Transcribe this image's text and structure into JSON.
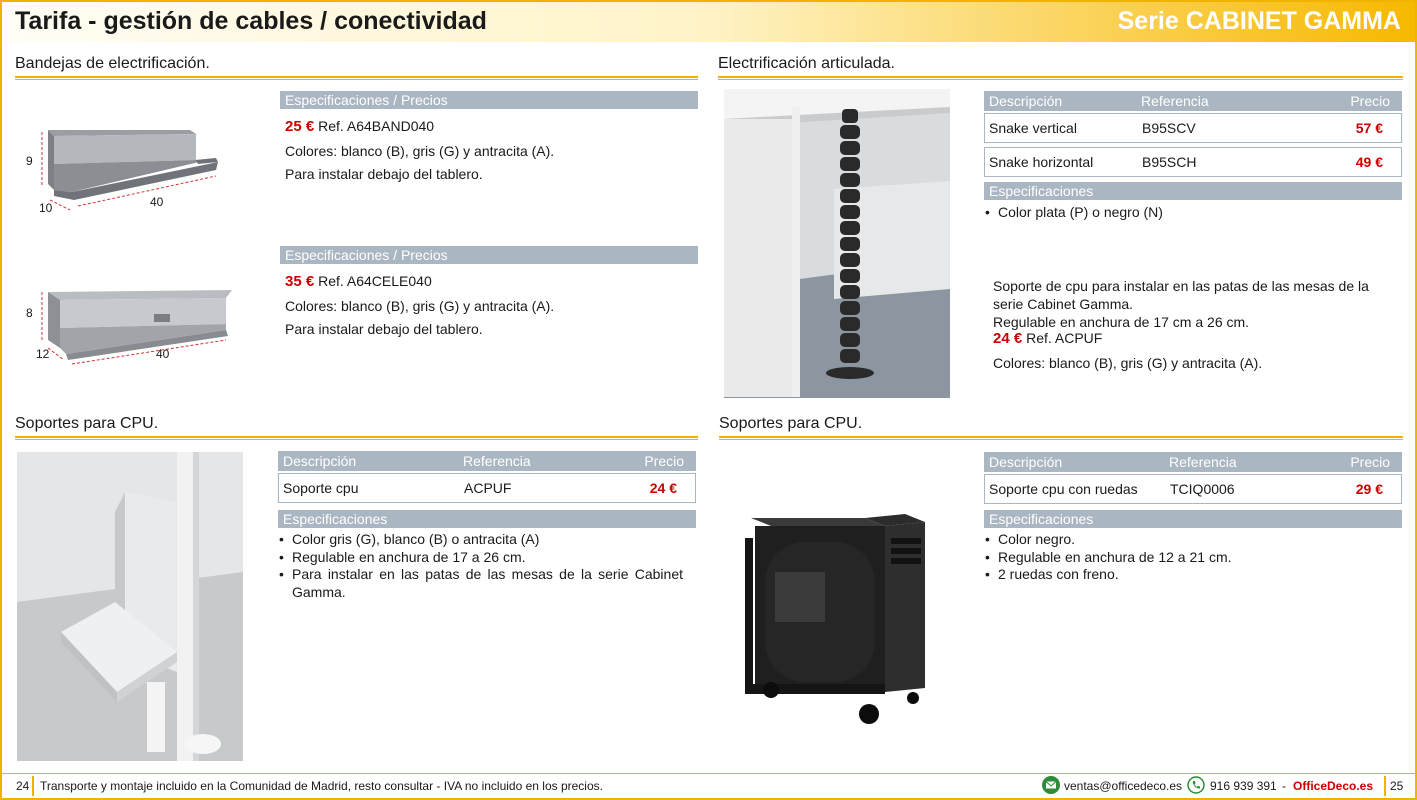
{
  "header": {
    "title": "Tarifa - gestión de cables / conectividad",
    "series": "Serie CABINET GAMMA"
  },
  "bandejas": {
    "title": "Bandejas de electrificación.",
    "items": [
      {
        "spec_label": "Especificaciones / Precios",
        "price": "25 €",
        "ref": "Ref. A64BAND040",
        "colors": "Colores: blanco (B), gris (G) y antracita (A).",
        "install": "Para instalar debajo del tablero.",
        "dims": {
          "h": "9",
          "w": "10",
          "l": "40"
        }
      },
      {
        "spec_label": "Especificaciones / Precios",
        "price": "35 €",
        "ref": "Ref. A64CELE040",
        "colors": "Colores: blanco (B), gris (G) y antracita (A).",
        "install": "Para instalar debajo del tablero.",
        "dims": {
          "h": "8",
          "w": "12",
          "l": "40"
        }
      }
    ]
  },
  "articulada": {
    "title": "Electrificación articulada.",
    "headers": {
      "desc": "Descripción",
      "ref": "Referencia",
      "price": "Precio"
    },
    "rows": [
      {
        "desc": "Snake vertical",
        "ref": "B95SCV",
        "price": "57 €"
      },
      {
        "desc": "Snake horizontal",
        "ref": "B95SCH",
        "price": "49 €"
      }
    ],
    "spec_label": "Especificaciones",
    "bullets": [
      "Color plata (P) o negro (N)"
    ],
    "cpu_note": {
      "line1": "Soporte de cpu para instalar en las patas de las mesas de la",
      "line2": "serie Cabinet Gamma.",
      "line3": "Regulable en anchura de 17 cm a 26 cm.",
      "price": "24 €",
      "ref": "Ref. ACPUF",
      "colors": "Colores: blanco (B), gris (G) y antracita (A)."
    }
  },
  "soporte_left": {
    "title": "Soportes para CPU.",
    "headers": {
      "desc": "Descripción",
      "ref": "Referencia",
      "price": "Precio"
    },
    "row": {
      "desc": "Soporte cpu",
      "ref": "ACPUF",
      "price": "24 €"
    },
    "spec_label": "Especificaciones",
    "bullets": [
      "Color gris (G), blanco (B) o antracita (A)",
      "Regulable en anchura de 17 a 26 cm.",
      "Para instalar en las patas de las mesas de la serie Cabinet",
      "Gamma."
    ]
  },
  "soporte_right": {
    "title": "Soportes para CPU.",
    "headers": {
      "desc": "Descripción",
      "ref": "Referencia",
      "price": "Precio"
    },
    "row": {
      "desc": "Soporte cpu con ruedas",
      "ref": "TCIQ0006",
      "price": "29 €"
    },
    "spec_label": "Especificaciones",
    "bullets": [
      "Color negro.",
      "Regulable en anchura de 12 a 21 cm.",
      "2 ruedas con freno."
    ]
  },
  "footer": {
    "page_left": "24",
    "note": "Transporte y montaje incluido en la Comunidad de Madrid, resto consultar - IVA no incluido en los precios.",
    "email": "ventas@officedeco.es",
    "phone": "916 939 391",
    "dash": "-",
    "brand": "OfficeDeco.es",
    "page_right": "25"
  },
  "colors": {
    "accent": "#f0b400",
    "header_bar": "#aab6c2",
    "price": "#cc0000"
  }
}
